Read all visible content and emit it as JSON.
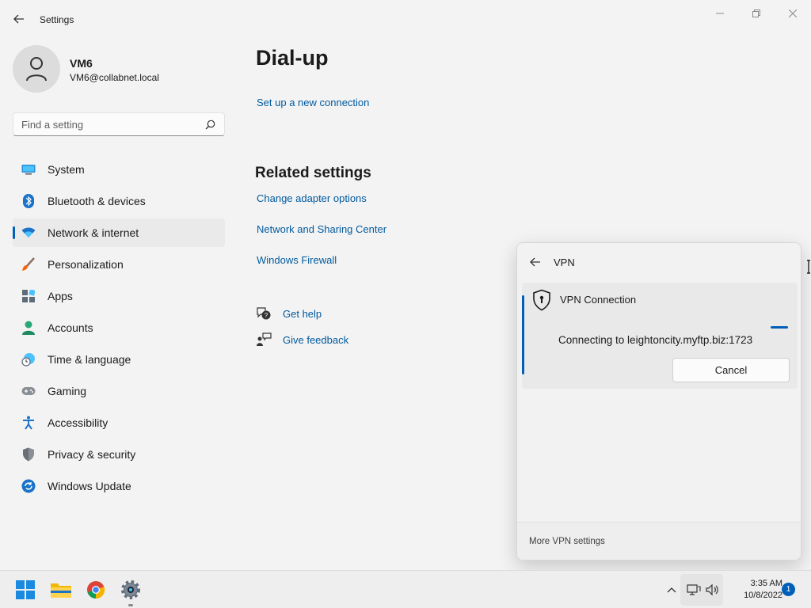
{
  "window": {
    "title": "Settings",
    "controls": {
      "minimize_icon": "minimize-icon",
      "maximize_icon": "maximize-icon",
      "close_icon": "close-icon"
    }
  },
  "profile": {
    "name": "VM6",
    "email": "VM6@collabnet.local"
  },
  "search": {
    "placeholder": "Find a setting"
  },
  "nav": {
    "items": [
      {
        "label": "System",
        "icon": "system-icon"
      },
      {
        "label": "Bluetooth & devices",
        "icon": "bluetooth-icon"
      },
      {
        "label": "Network & internet",
        "icon": "wifi-icon",
        "selected": true
      },
      {
        "label": "Personalization",
        "icon": "brush-icon"
      },
      {
        "label": "Apps",
        "icon": "apps-icon"
      },
      {
        "label": "Accounts",
        "icon": "person-icon"
      },
      {
        "label": "Time & language",
        "icon": "clock-globe-icon"
      },
      {
        "label": "Gaming",
        "icon": "gamepad-icon"
      },
      {
        "label": "Accessibility",
        "icon": "accessibility-icon"
      },
      {
        "label": "Privacy & security",
        "icon": "shield-icon"
      },
      {
        "label": "Windows Update",
        "icon": "update-icon"
      }
    ]
  },
  "main": {
    "title": "Dial-up",
    "setup_link": "Set up a new connection",
    "related": {
      "title": "Related settings",
      "links": [
        "Change adapter options",
        "Network and Sharing Center",
        "Windows Firewall"
      ]
    },
    "help": {
      "get_help": "Get help",
      "give_feedback": "Give feedback"
    }
  },
  "vpn_flyout": {
    "title": "VPN",
    "connection_name": "VPN Connection",
    "status": "Connecting to leightoncity.myftp.biz:1723",
    "cancel_label": "Cancel",
    "footer_link": "More VPN settings"
  },
  "taskbar": {
    "apps": [
      "start-icon",
      "file-explorer-icon",
      "chrome-icon",
      "settings-icon"
    ],
    "time": "3:35 AM",
    "date": "10/8/2022",
    "notification_count": "1"
  },
  "colors": {
    "accent": "#005fb8",
    "link": "#005a9e",
    "background": "#f3f3f3"
  }
}
